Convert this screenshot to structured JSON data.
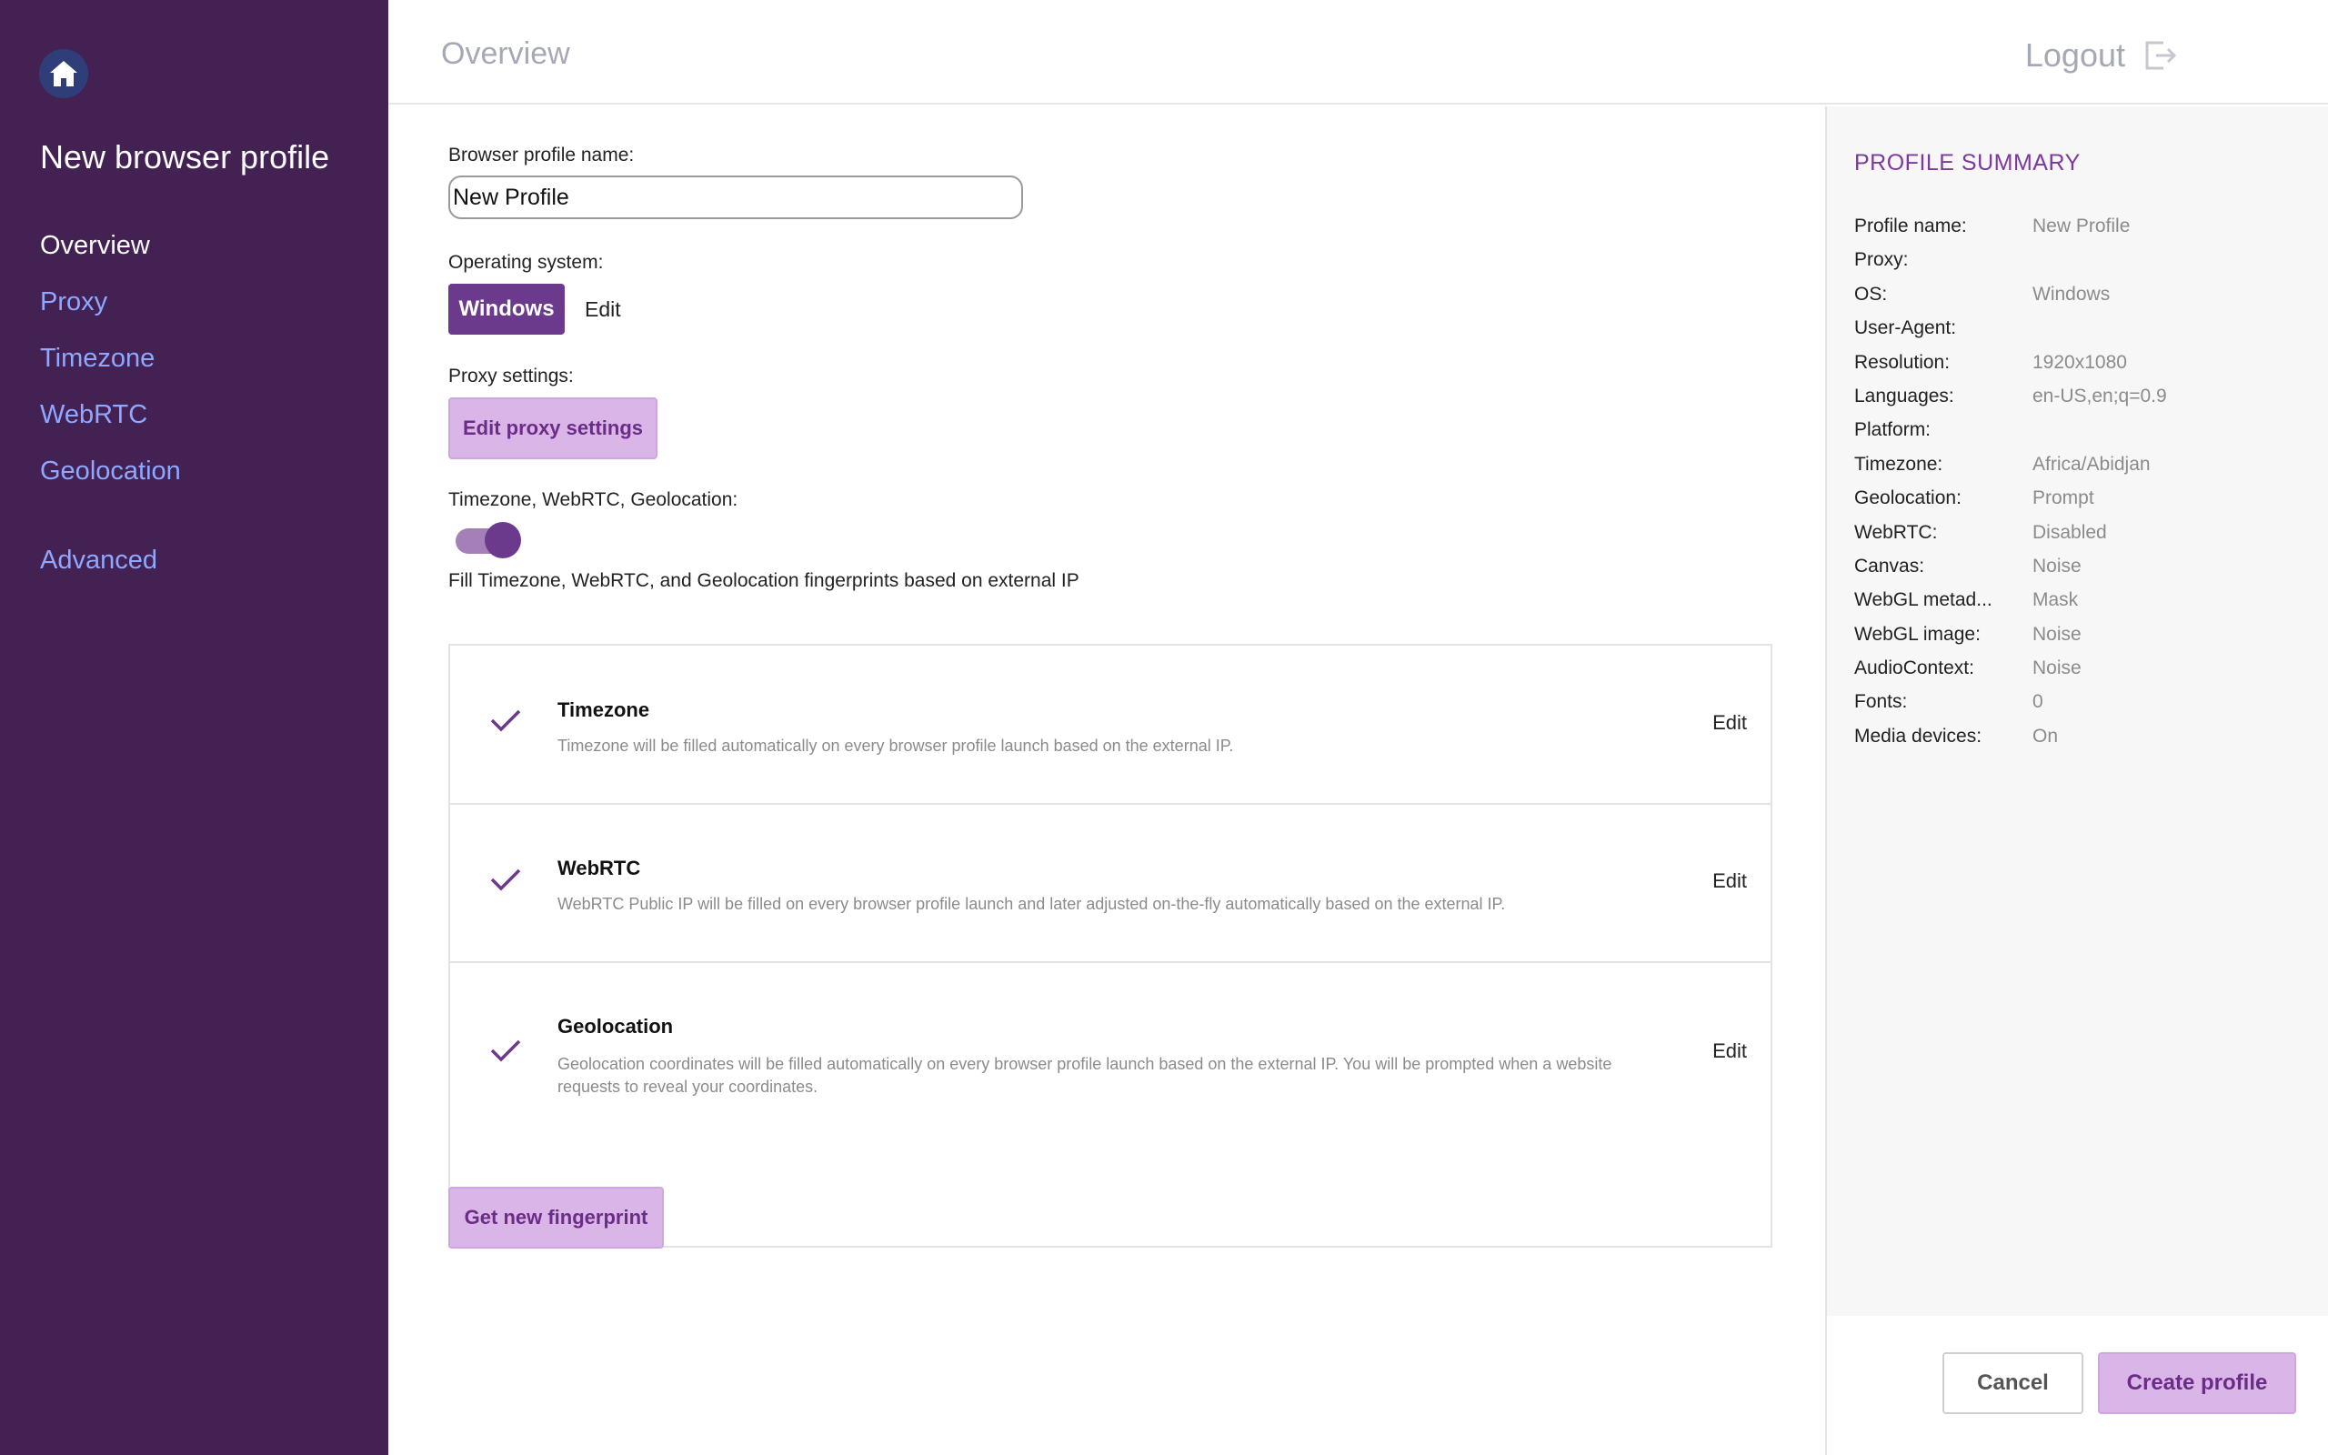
{
  "sidebar": {
    "home_icon": "home-icon",
    "title": "New browser profile",
    "items": [
      {
        "label": "Overview",
        "active": true
      },
      {
        "label": "Proxy"
      },
      {
        "label": "Timezone"
      },
      {
        "label": "WebRTC"
      },
      {
        "label": "Geolocation"
      },
      {
        "label": "Advanced"
      }
    ],
    "bg_color": "#432153",
    "link_color": "#8fa8ff"
  },
  "header": {
    "title": "Overview",
    "logout_label": "Logout",
    "logout_icon": "logout-icon"
  },
  "form": {
    "profile_name_label": "Browser profile name:",
    "profile_name_value": "New Profile",
    "os_label": "Operating system:",
    "os_value": "Windows",
    "os_edit": "Edit",
    "proxy_label": "Proxy settings:",
    "proxy_button": "Edit proxy settings",
    "auto_label": "Timezone, WebRTC, Geolocation:",
    "auto_toggle_on": true,
    "auto_desc": "Fill Timezone, WebRTC, and Geolocation fingerprints based on external IP",
    "fingerprint_button": "Get new fingerprint"
  },
  "cards": [
    {
      "title": "Timezone",
      "desc": "Timezone will be filled automatically on every browser profile launch based on the external IP.",
      "edit": "Edit"
    },
    {
      "title": "WebRTC",
      "desc": "WebRTC Public IP will be filled on every browser profile launch and later adjusted on-the-fly automatically based on the external IP.",
      "edit": "Edit"
    },
    {
      "title": "Geolocation",
      "desc": "Geolocation coordinates will be filled automatically on every browser profile launch based on the external IP. You will be prompted when a website requests to reveal your coordinates.",
      "edit": "Edit"
    }
  ],
  "summary": {
    "title": "PROFILE SUMMARY",
    "rows": [
      {
        "key": "Profile name:",
        "value": "New Profile"
      },
      {
        "key": "Proxy:",
        "value": ""
      },
      {
        "key": "OS:",
        "value": "Windows"
      },
      {
        "key": "User-Agent:",
        "value": ""
      },
      {
        "key": "Resolution:",
        "value": "1920x1080"
      },
      {
        "key": "Languages:",
        "value": "en-US,en;q=0.9"
      },
      {
        "key": "Platform:",
        "value": ""
      },
      {
        "key": "Timezone:",
        "value": "Africa/Abidjan"
      },
      {
        "key": "Geolocation:",
        "value": "Prompt"
      },
      {
        "key": "WebRTC:",
        "value": "Disabled"
      },
      {
        "key": "Canvas:",
        "value": "Noise"
      },
      {
        "key": "WebGL metad...",
        "value": "Mask"
      },
      {
        "key": "WebGL image:",
        "value": "Noise"
      },
      {
        "key": "AudioContext:",
        "value": "Noise"
      },
      {
        "key": "Fonts:",
        "value": "0"
      },
      {
        "key": "Media devices:",
        "value": "On"
      }
    ]
  },
  "footer": {
    "cancel": "Cancel",
    "create": "Create profile"
  },
  "colors": {
    "accent": "#6c3a8c",
    "accent_light": "#dab5e8",
    "summary_title": "#7c3a9e"
  }
}
